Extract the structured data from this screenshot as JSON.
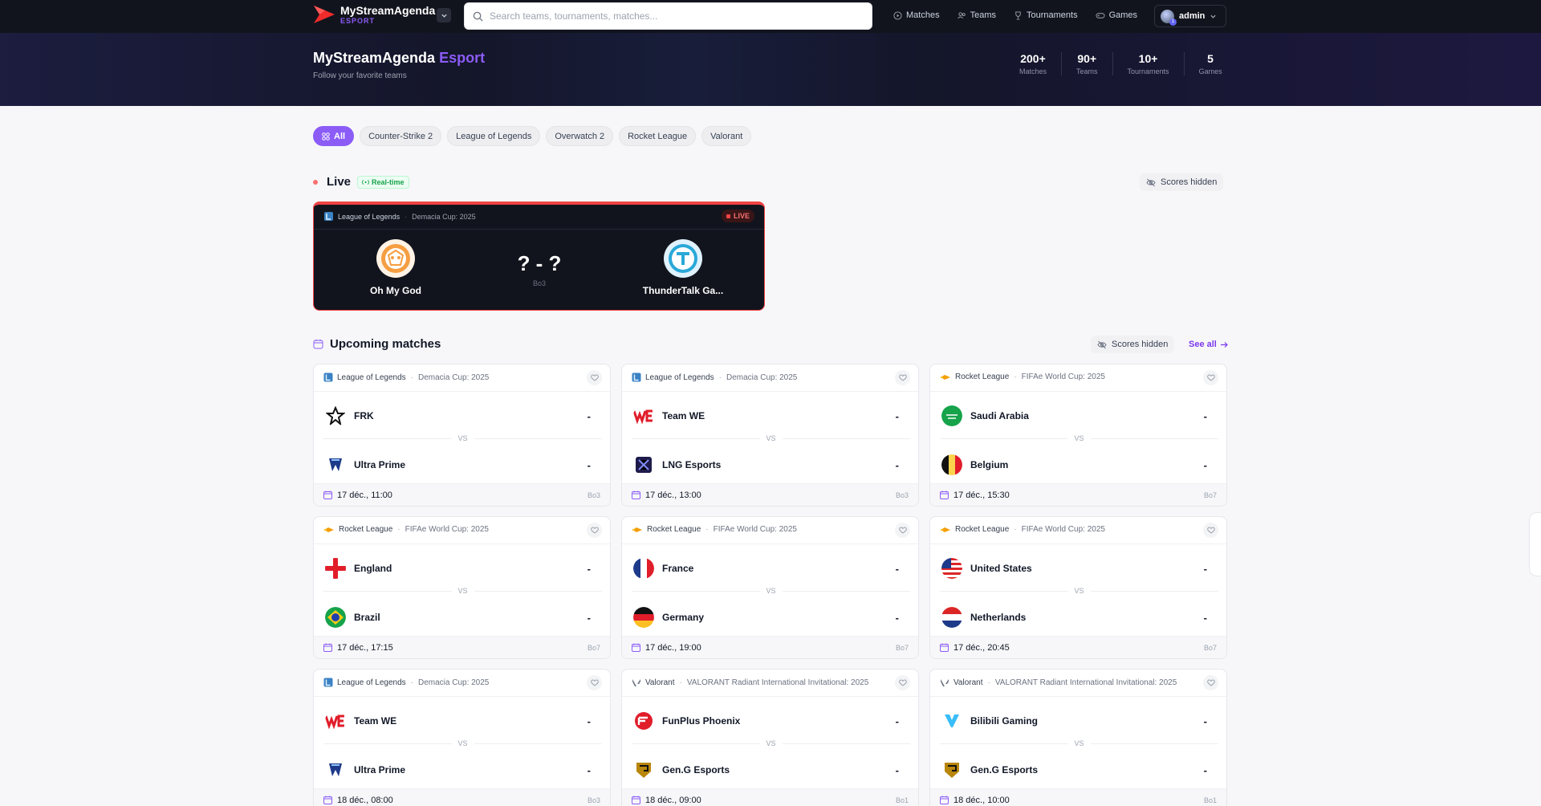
{
  "brand": {
    "name": "MyStreamAgenda",
    "sub": "ESPORT"
  },
  "search": {
    "placeholder": "Search teams, tournaments, matches..."
  },
  "nav": [
    {
      "label": "Matches",
      "icon": "play-circle-icon"
    },
    {
      "label": "Teams",
      "icon": "users-icon"
    },
    {
      "label": "Tournaments",
      "icon": "trophy-icon"
    },
    {
      "label": "Games",
      "icon": "gamepad-icon"
    }
  ],
  "user": {
    "name": "admin",
    "badge": "1"
  },
  "hero": {
    "title": "MyStreamAgenda",
    "title_accent": "Esport",
    "subtitle": "Follow your favorite teams",
    "stats": [
      {
        "value": "200+",
        "label": "Matches"
      },
      {
        "value": "90+",
        "label": "Teams"
      },
      {
        "value": "10+",
        "label": "Tournaments"
      },
      {
        "value": "5",
        "label": "Games"
      }
    ]
  },
  "filters": [
    "All",
    "Counter-Strike 2",
    "League of Legends",
    "Overwatch 2",
    "Rocket League",
    "Valorant"
  ],
  "live": {
    "title": "Live",
    "badge": "Real-time",
    "scores_hidden": "Scores hidden",
    "match": {
      "game": "League of Legends",
      "tournament": "Demacia Cup: 2025",
      "status": "LIVE",
      "home": "Oh My God",
      "away": "ThunderTalk Ga...",
      "score": "? - ?",
      "format": "Bo3"
    }
  },
  "upcoming": {
    "title": "Upcoming matches",
    "scores_hidden": "Scores hidden",
    "see_all": "See all",
    "vs": "VS",
    "matches": [
      {
        "game": "League of Legends",
        "tournament": "Demacia Cup: 2025",
        "home": "FRK",
        "away": "Ultra Prime",
        "home_score": "-",
        "away_score": "-",
        "date": "17 déc., 11:00",
        "format": "Bo3"
      },
      {
        "game": "League of Legends",
        "tournament": "Demacia Cup: 2025",
        "home": "Team WE",
        "away": "LNG Esports",
        "home_score": "-",
        "away_score": "-",
        "date": "17 déc., 13:00",
        "format": "Bo3"
      },
      {
        "game": "Rocket League",
        "tournament": "FIFAe World Cup: 2025",
        "home": "Saudi Arabia",
        "away": "Belgium",
        "home_score": "-",
        "away_score": "-",
        "date": "17 déc., 15:30",
        "format": "Bo7"
      },
      {
        "game": "Rocket League",
        "tournament": "FIFAe World Cup: 2025",
        "home": "England",
        "away": "Brazil",
        "home_score": "-",
        "away_score": "-",
        "date": "17 déc., 17:15",
        "format": "Bo7"
      },
      {
        "game": "Rocket League",
        "tournament": "FIFAe World Cup: 2025",
        "home": "France",
        "away": "Germany",
        "home_score": "-",
        "away_score": "-",
        "date": "17 déc., 19:00",
        "format": "Bo7"
      },
      {
        "game": "Rocket League",
        "tournament": "FIFAe World Cup: 2025",
        "home": "United States",
        "away": "Netherlands",
        "home_score": "-",
        "away_score": "-",
        "date": "17 déc., 20:45",
        "format": "Bo7"
      },
      {
        "game": "League of Legends",
        "tournament": "Demacia Cup: 2025",
        "home": "Team WE",
        "away": "Ultra Prime",
        "home_score": "-",
        "away_score": "-",
        "date": "18 déc., 08:00",
        "format": "Bo3"
      },
      {
        "game": "Valorant",
        "tournament": "VALORANT Radiant International Invitational: 2025",
        "home": "FunPlus Phoenix",
        "away": "Gen.G Esports",
        "home_score": "-",
        "away_score": "-",
        "date": "18 déc., 09:00",
        "format": "Bo1"
      },
      {
        "game": "Valorant",
        "tournament": "VALORANT Radiant International Invitational: 2025",
        "home": "Bilibili Gaming",
        "away": "Gen.G Esports",
        "home_score": "-",
        "away_score": "-",
        "date": "18 déc., 10:00",
        "format": "Bo1"
      }
    ]
  },
  "colors": {
    "accent": "#8b5cf6",
    "live": "#ef4444",
    "nav_bg": "#12141d",
    "realtime": "#16a34a"
  }
}
